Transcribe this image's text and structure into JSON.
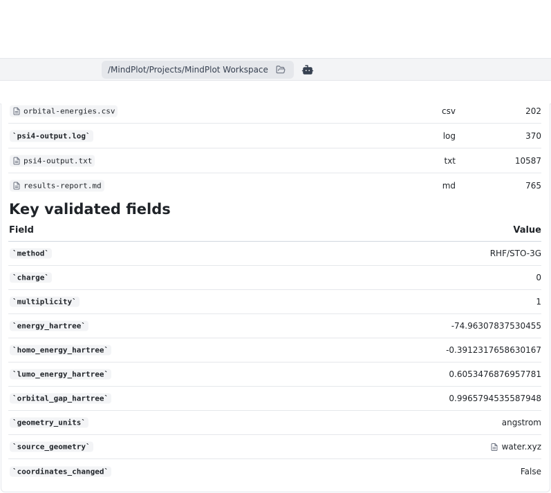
{
  "path_bar": {
    "path": "/MindPlot/Projects/MindPlot Workspace",
    "folder_icon": "folder-open-icon",
    "bot_icon": "bot-icon"
  },
  "files": [
    {
      "name": "orbital-energies.csv",
      "style": "file",
      "type": "csv",
      "size": "202"
    },
    {
      "name": "`psi4-output.log`",
      "style": "code",
      "type": "log",
      "size": "370"
    },
    {
      "name": "psi4-output.txt",
      "style": "file",
      "type": "txt",
      "size": "10587"
    },
    {
      "name": "results-report.md",
      "style": "file",
      "type": "md",
      "size": "765"
    }
  ],
  "key_fields": {
    "title": "Key validated fields",
    "header_field": "Field",
    "header_value": "Value",
    "rows": [
      {
        "field": "`method`",
        "value": "RHF/STO-3G"
      },
      {
        "field": "`charge`",
        "value": "0"
      },
      {
        "field": "`multiplicity`",
        "value": "1"
      },
      {
        "field": "`energy_hartree`",
        "value": "-74.96307837530455"
      },
      {
        "field": "`homo_energy_hartree`",
        "value": "-0.3912317658630167"
      },
      {
        "field": "`lumo_energy_hartree`",
        "value": "0.6053476876957781"
      },
      {
        "field": "`orbital_gap_hartree`",
        "value": "0.9965794535587948"
      },
      {
        "field": "`geometry_units`",
        "value": "angstrom"
      },
      {
        "field": "`source_geometry`",
        "value": "water.xyz",
        "link": true
      },
      {
        "field": "`coordinates_changed`",
        "value": "False"
      }
    ]
  },
  "colors": {
    "border": "#e5e7eb",
    "chip_bg": "#f3f4f6",
    "text": "#1f2328",
    "muted": "#6b7280"
  }
}
